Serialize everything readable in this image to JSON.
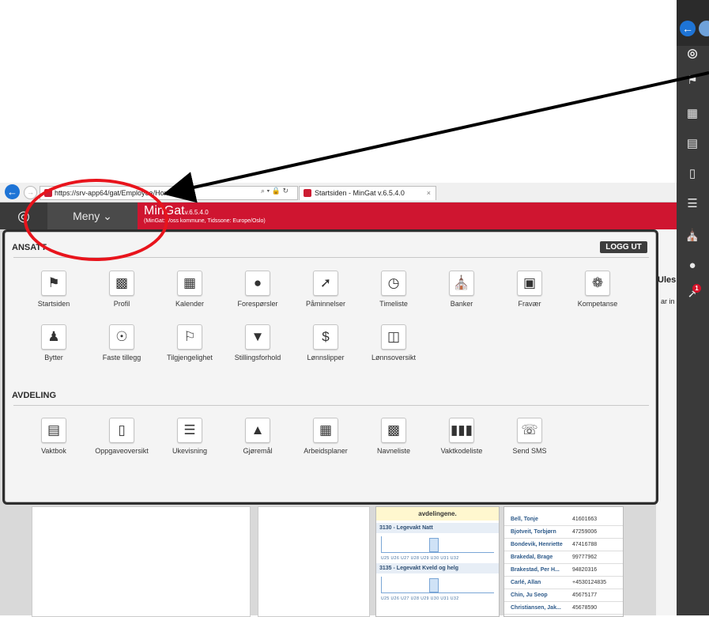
{
  "browser": {
    "url": "https://srv-app64/gat/Employee/Home",
    "tab_title": "Startsiden - MinGat v.6.5.4.0",
    "tab_close": "×",
    "url_tools": "⌕ ▾ 🔒 ↻"
  },
  "header": {
    "menu_label": "Meny ⌄",
    "app_name": "MinGat",
    "version": "v.6.5.4.0",
    "subtitle": "(MinGat: Voss kommune, Tidssone: Europe/Oslo)",
    "brand_color": "#cf1530"
  },
  "panel": {
    "logout_label": "LOGG UT",
    "sections": [
      {
        "title": "ANSATT",
        "items": [
          {
            "label": "Startsiden",
            "icon": "flag-icon"
          },
          {
            "label": "Profil",
            "icon": "id-card-icon"
          },
          {
            "label": "Kalender",
            "icon": "calendar-icon"
          },
          {
            "label": "Forespørsler",
            "icon": "speech-bubble-icon"
          },
          {
            "label": "Påminnelser",
            "icon": "pushpin-icon"
          },
          {
            "label": "Timeliste",
            "icon": "clock-icon"
          },
          {
            "label": "Banker",
            "icon": "bank-icon"
          },
          {
            "label": "Fravær",
            "icon": "briefcase-icon"
          },
          {
            "label": "Kompetanse",
            "icon": "award-icon"
          },
          {
            "label": "Bytter",
            "icon": "users-icon"
          },
          {
            "label": "Faste tillegg",
            "icon": "coins-icon"
          },
          {
            "label": "Tilgjengelighet",
            "icon": "flag-outline-icon"
          },
          {
            "label": "Stillingsforhold",
            "icon": "tie-icon"
          },
          {
            "label": "Lønnslipper",
            "icon": "payslip-icon"
          },
          {
            "label": "Lønnsoversikt",
            "icon": "wallet-icon"
          }
        ]
      },
      {
        "title": "AVDELING",
        "items": [
          {
            "label": "Vaktbok",
            "icon": "table-icon"
          },
          {
            "label": "Oppgaveoversikt",
            "icon": "clipboard-icon"
          },
          {
            "label": "Ukevisning",
            "icon": "list-icon"
          },
          {
            "label": "Gjøremål",
            "icon": "bell-icon"
          },
          {
            "label": "Arbeidsplaner",
            "icon": "grid-icon"
          },
          {
            "label": "Navneliste",
            "icon": "contact-book-icon"
          },
          {
            "label": "Vaktkodeliste",
            "icon": "barcode-icon"
          },
          {
            "label": "Send SMS",
            "icon": "phone-icon"
          }
        ]
      }
    ]
  },
  "background": {
    "partial_text_1": "Ules",
    "partial_text_2": "ar in",
    "notice": "avdelingene.",
    "groups": [
      {
        "title": "3130 - Legevakt Natt"
      },
      {
        "title": "3135 - Legevakt Kveld og helg"
      }
    ],
    "axis_labels": "U25 U26 U27 U28 U29 U30 U31 U32",
    "people": [
      {
        "name": "Bell, Tonje",
        "phone": "41601663"
      },
      {
        "name": "Bjotveit, Torbjørn",
        "phone": "47259006"
      },
      {
        "name": "Bondevik, Henriette",
        "phone": "47416788"
      },
      {
        "name": "Brakedal, Brage",
        "phone": "99777962"
      },
      {
        "name": "Brakestad, Per H...",
        "phone": "94820316"
      },
      {
        "name": "Carlé, Allan",
        "phone": "+4530124835"
      },
      {
        "name": "Chin, Ju Seop",
        "phone": "45675177"
      },
      {
        "name": "Christiansen, Jak...",
        "phone": "45678590"
      }
    ]
  },
  "sidebar": {
    "badge_count": "1",
    "icons": [
      "back-icon",
      "eye-logo-icon",
      "flag-icon",
      "calendar-icon",
      "table-icon",
      "clipboard-icon",
      "list-icon",
      "bank-icon",
      "speech-bubble-icon",
      "pushpin-icon"
    ]
  },
  "annotation": {
    "oval_color": "#e8141c",
    "arrow_color": "#000000"
  }
}
